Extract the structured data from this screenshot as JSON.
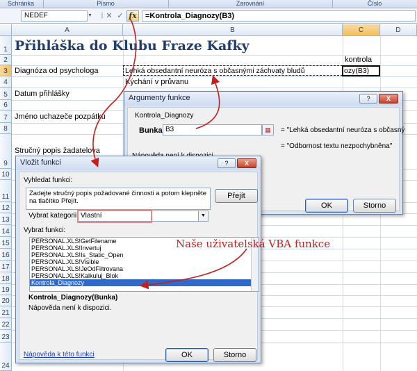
{
  "ribbon": {
    "groups": [
      "Schránka",
      "Písmo",
      "Zarovnání",
      "Číslo"
    ]
  },
  "formula_bar": {
    "name_box": "NEDEF",
    "cancel_glyph": "✕",
    "enter_glyph": "✓",
    "fx_label": "fx",
    "formula": "=Kontrola_Diagnozy(B3)"
  },
  "sheet": {
    "columns": [
      "A",
      "B",
      "C",
      "D"
    ],
    "rows": [
      "1",
      "2",
      "3",
      "4",
      "5",
      "6",
      "7",
      "8",
      "9",
      "10",
      "11",
      "12",
      "13",
      "14",
      "15",
      "16",
      "17",
      "18",
      "19",
      "20",
      "21",
      "22",
      "23",
      "24"
    ],
    "title": "Přihláška do Klubu Fraze Kafky",
    "c2": "kontrola",
    "a3": "Diagnóza od psychologa",
    "b3": "Lehká obsedantní neuróza s občasnými záchvaty bludů",
    "c3": "ozy(B3)",
    "b4": "Kýchání v průvanu",
    "a5": "Datum přihlášky",
    "a7": "Jméno uchazeče pozpátku",
    "a9": "Stručný popis žadatelova"
  },
  "args_dialog": {
    "title": "Argumenty funkce",
    "help_btn": "?",
    "close_btn": "X",
    "function_name": "Kontrola_Diagnozy",
    "arg_label": "Bunka",
    "arg_value": "B3",
    "arg_result": "= \"Lehká obsedantní neuróza s občasný",
    "result_line": "= \"Odbornost textu nezpochybněna\"",
    "help_text": "Nápověda není k dispozici.",
    "ok": "OK",
    "cancel": "Storno"
  },
  "insert_dialog": {
    "title": "Vložit funkci",
    "help_btn": "?",
    "close_btn": "X",
    "search_label": "Vyhledat funkci:",
    "search_hint": "Zadejte stručný popis požadované činnosti a potom klepněte na tlačítko Přejít.",
    "go": "Přejít",
    "category_label": "Vybrat kategorii:",
    "category_value": "Vlastní",
    "function_label": "Vybrat funkci:",
    "functions": [
      "PERSONAL.XLS!GetFilename",
      "PERSONAL.XLS!Invertuj",
      "PERSONAL.XLS!Is_Static_Open",
      "PERSONAL.XLS!Visible",
      "PERSONAL.XLS!JeOdFiltrovana",
      "PERSONAL.XLS!Kalkuluj_Blok",
      "Kontrola_Diagnozy"
    ],
    "signature": "Kontrola_Diagnozy(Bunka)",
    "help_text": "Nápověda není k dispozici.",
    "help_link": "Nápověda k této funkci",
    "ok": "OK",
    "cancel": "Storno"
  },
  "annotation": "Naše uživatelská VBA funkce",
  "colors": {
    "annotation": "#c41e1e",
    "title": "#1f3e6e",
    "selection": "#3169c6"
  }
}
